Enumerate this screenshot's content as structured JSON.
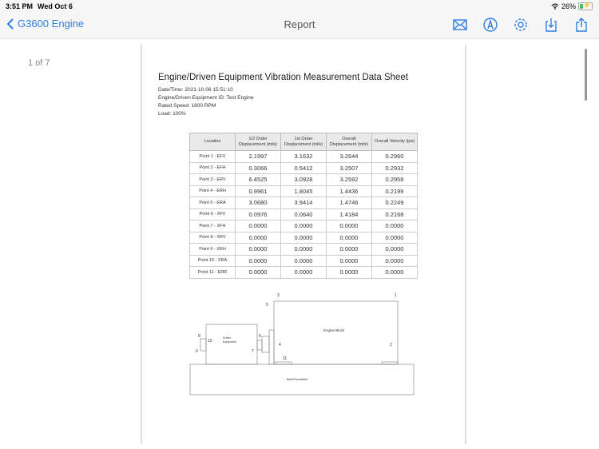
{
  "status": {
    "time": "3:51 PM",
    "date": "Wed Oct 6",
    "battery": "26%"
  },
  "nav": {
    "back_label": "G3600 Engine",
    "title": "Report",
    "tools": [
      {
        "name": "mail-icon"
      },
      {
        "name": "markup-icon"
      },
      {
        "name": "gear-icon"
      },
      {
        "name": "download-icon"
      },
      {
        "name": "share-icon"
      }
    ]
  },
  "viewer": {
    "page_indicator": "1 of 7"
  },
  "doc": {
    "title": "Engine/Driven Equipment Vibration Measurement Data Sheet",
    "meta": [
      "Date/Time: 2021-10-06 15:51:10",
      "Engine/Driven Equipment ID: Test Engine",
      "Rated Speed: 1800 RPM",
      "Load: 100%"
    ],
    "table": {
      "headers": [
        "Location",
        "1/2 Order Displacement (mils)",
        "1st Order Displacement (mils)",
        "Overall Displacement (mils)",
        "Overall Velocity (ips)"
      ],
      "rows": [
        [
          "Point 1 - EFV",
          "2.1997",
          "3.1632",
          "3.2644",
          "0.2960"
        ],
        [
          "Point 2 - EFH",
          "0.3066",
          "0.5412",
          "3.2507",
          "0.2932"
        ],
        [
          "Point 3 - ERV",
          "6.4525",
          "3.0928",
          "3.2592",
          "0.2958"
        ],
        [
          "Point 4 - ERH",
          "0.9961",
          "1.8045",
          "1.4436",
          "0.2199"
        ],
        [
          "Point 5 - ERA",
          "3.0680",
          "3.9414",
          "1.4746",
          "0.2249"
        ],
        [
          "Point 6 - XFV",
          "0.0976",
          "0.0640",
          "1.4184",
          "0.2168"
        ],
        [
          "Point 7 - XFH",
          "0.0000",
          "0.0000",
          "0.0000",
          "0.0000"
        ],
        [
          "Point 8 - XRV",
          "0.0000",
          "0.0000",
          "0.0000",
          "0.0000"
        ],
        [
          "Point 9 - XRH",
          "0.0000",
          "0.0000",
          "0.0000",
          "0.0000"
        ],
        [
          "Point 10 - XRA",
          "0.0000",
          "0.0000",
          "0.0000",
          "0.0000"
        ],
        [
          "Point 11 - ERR",
          "0.0000",
          "0.0000",
          "0.0000",
          "0.0000"
        ]
      ]
    },
    "diagram": {
      "engine_label": "Engine Block",
      "driven_label_1": "Driven",
      "driven_label_2": "Equipment",
      "base_label": "Base/Foundation",
      "points": [
        "1",
        "2",
        "3",
        "4",
        "5",
        "6",
        "7",
        "8",
        "9",
        "10",
        "11"
      ]
    }
  }
}
